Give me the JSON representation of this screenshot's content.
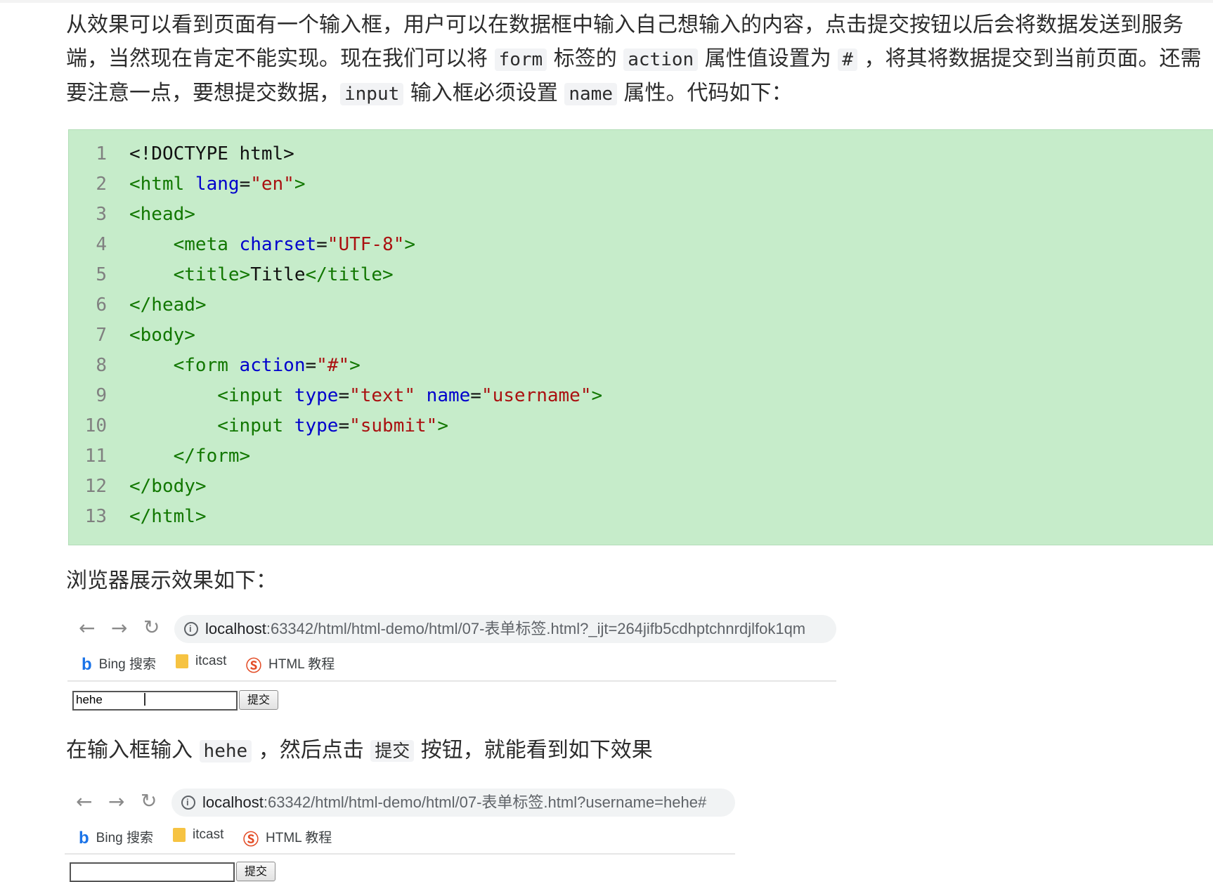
{
  "intro": {
    "t1": "从效果可以看到页面有一个输入框，用户可以在数据框中输入自己想输入的内容，点击提交按钮以后会将数据发送到服务端，当然现在肯定不能实现。现在我们可以将 ",
    "c1": "form",
    "t2": " 标签的 ",
    "c2": "action",
    "t3": " 属性值设置为 ",
    "c3": "#",
    "t4": " ，将其将数据提交到当前页面。还需要注意一点，要想提交数据，",
    "c4": "input",
    "t5": " 输入框必须设置 ",
    "c5": "name",
    "t6": " 属性。代码如下："
  },
  "code": {
    "line_numbers": [
      "1",
      "2",
      "3",
      "4",
      "5",
      "6",
      "7",
      "8",
      "9",
      "10",
      "11",
      "12",
      "13"
    ],
    "l1": {
      "tag": "<!DOCTYPE html>"
    },
    "l2": {
      "open": "<html",
      "attr": " lang",
      "eq": "=",
      "val": "\"en\"",
      "close": ">"
    },
    "l3": {
      "tag": "<head>"
    },
    "l4": {
      "indent": "    ",
      "open": "<meta",
      "attr": " charset",
      "eq": "=",
      "val": "\"UTF-8\"",
      "close": ">"
    },
    "l5": {
      "indent": "    ",
      "open": "<title>",
      "text": "Title",
      "close": "</title>"
    },
    "l6": {
      "tag": "</head>"
    },
    "l7": {
      "tag": "<body>"
    },
    "l8": {
      "indent": "    ",
      "open": "<form",
      "attr": " action",
      "eq": "=",
      "val": "\"#\"",
      "close": ">"
    },
    "l9": {
      "indent": "        ",
      "open": "<input",
      "attr1": " type",
      "eq": "=",
      "val1": "\"text\"",
      "attr2": " name",
      "val2": "\"username\"",
      "close": ">"
    },
    "l10": {
      "indent": "        ",
      "open": "<input",
      "attr": " type",
      "eq": "=",
      "val": "\"submit\"",
      "close": ">"
    },
    "l11": {
      "indent": "    ",
      "tag": "</form>"
    },
    "l12": {
      "tag": "</body>"
    },
    "l13": {
      "tag": "</html>"
    }
  },
  "caption1": "浏览器展示效果如下：",
  "browser1": {
    "back_icon": "arrow-left-icon",
    "url_host": "localhost",
    "url_path": ":63342/html/html-demo/html/07-表单标签.html?_ijt=264jifb5cdhptchnrdjlfok1qm",
    "bookmarks": [
      "Bing 搜索",
      "itcast",
      "HTML 教程"
    ],
    "input_value": "hehe",
    "submit_label": "提交"
  },
  "caption2": {
    "t1": "在输入框输入 ",
    "c1": "hehe",
    "t2": " ，然后点击 ",
    "c2": "提交",
    "t3": " 按钮，就能看到如下效果"
  },
  "browser2": {
    "url_host": "localhost",
    "url_path": ":63342/html/html-demo/html/07-表单标签.html?username=hehe#",
    "bookmarks": [
      "Bing 搜索",
      "itcast",
      "HTML 教程"
    ],
    "input_value": "",
    "submit_label": "提交"
  }
}
